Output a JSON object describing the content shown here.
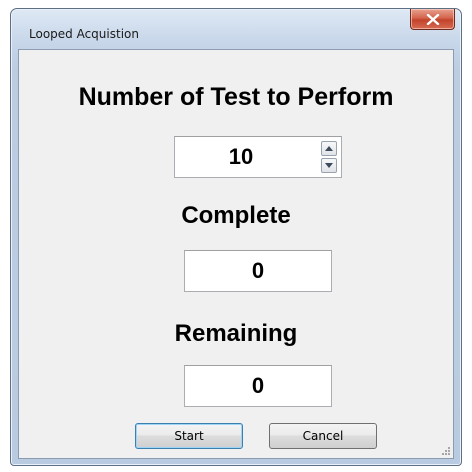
{
  "window": {
    "title": "Looped Acquistion",
    "close_icon": "close-icon"
  },
  "tests": {
    "heading": "Number of Test to Perform",
    "value": "10",
    "spin_icons": [
      "chevron-up-icon",
      "chevron-down-icon"
    ]
  },
  "complete": {
    "heading": "Complete",
    "value": "0"
  },
  "remaining": {
    "heading": "Remaining",
    "value": "0"
  },
  "buttons": {
    "start": "Start",
    "cancel": "Cancel"
  },
  "colors": {
    "close_button": "#c2432b",
    "default_button_border": "#3c7fb1",
    "frame": "#bccde2"
  }
}
